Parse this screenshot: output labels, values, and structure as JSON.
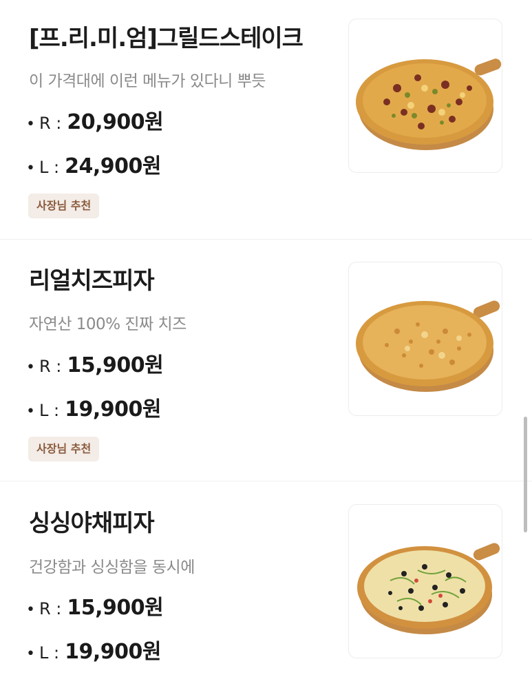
{
  "menu": {
    "items": [
      {
        "name": "[프.리.미.엄]그릴드스테이크",
        "description": "이 가격대에 이런 메뉴가 있다니 뿌듯",
        "bullet": "•",
        "prices": [
          {
            "size": "R :",
            "price": "20,900원"
          },
          {
            "size": "L :",
            "price": "24,900원"
          }
        ],
        "badge": "사장님 추천",
        "image_icon": "steak-pizza-image"
      },
      {
        "name": "리얼치즈피자",
        "description": "자연산 100% 진짜 치즈",
        "bullet": "•",
        "prices": [
          {
            "size": "R :",
            "price": "15,900원"
          },
          {
            "size": "L :",
            "price": "19,900원"
          }
        ],
        "badge": "사장님 추천",
        "image_icon": "cheese-pizza-image"
      },
      {
        "name": "싱싱야채피자",
        "description": "건강함과 싱싱함을 동시에",
        "bullet": "•",
        "prices": [
          {
            "size": "R :",
            "price": "15,900원"
          },
          {
            "size": "L :",
            "price": "19,900원"
          }
        ],
        "image_icon": "veggie-pizza-image"
      }
    ]
  },
  "colors": {
    "badge_bg": "#f3ece7",
    "badge_text": "#8a5a3c",
    "description": "#8a8a8a",
    "divider": "#efefef"
  }
}
